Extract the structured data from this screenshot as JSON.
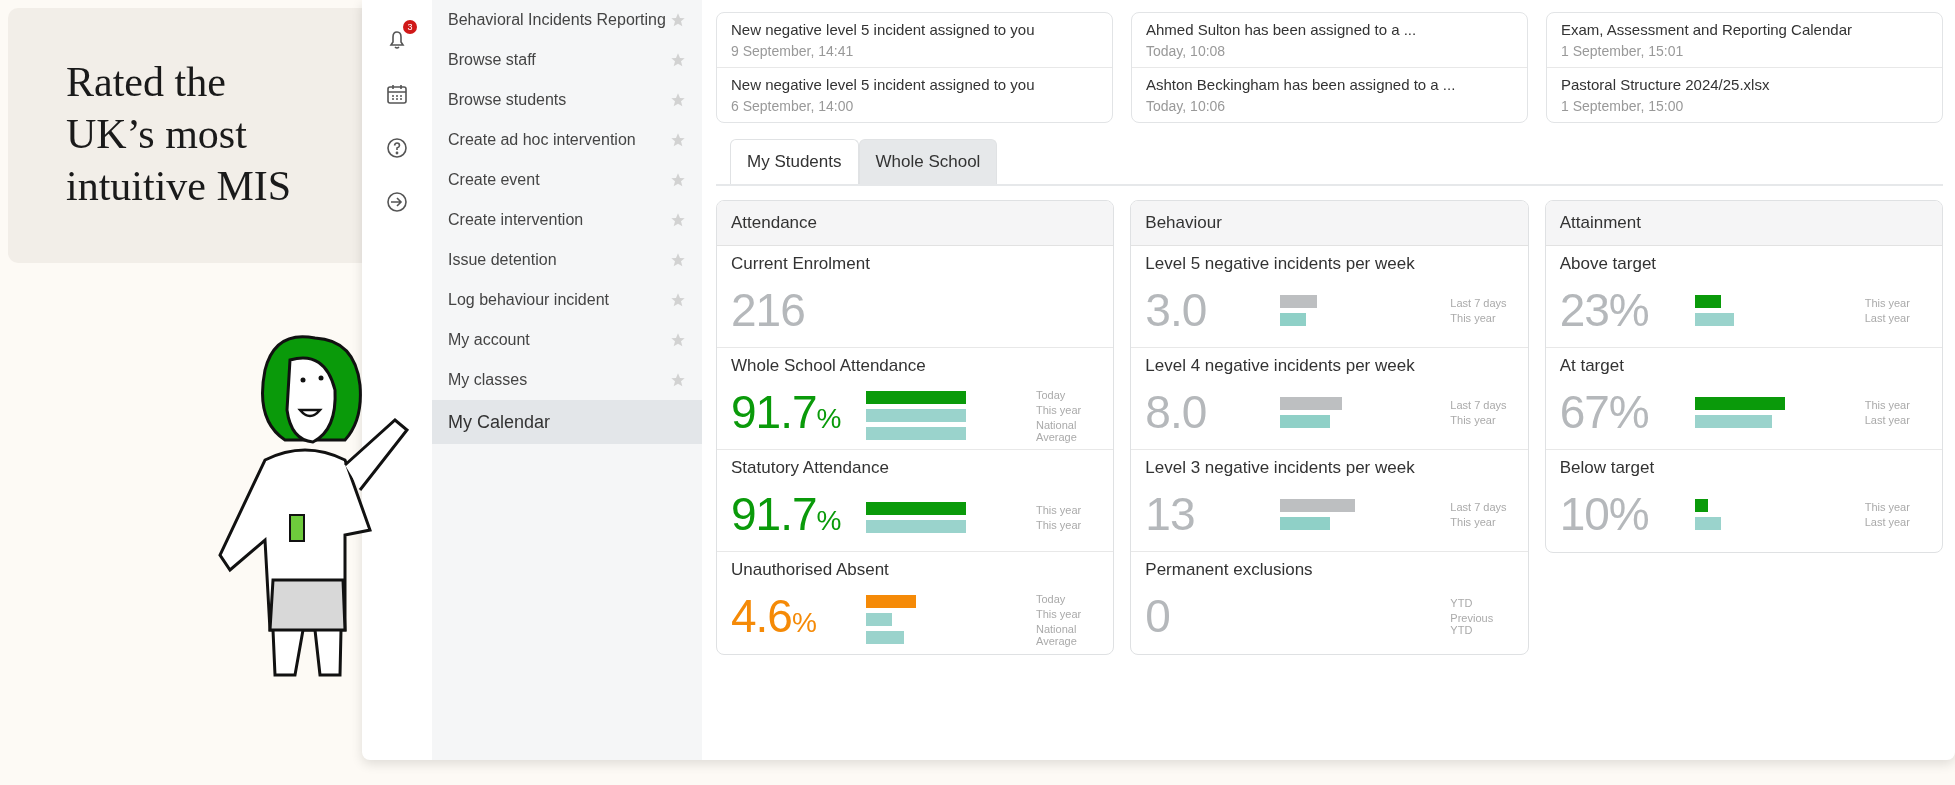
{
  "callout": {
    "text": "Rated the UK’s most intuitive MIS"
  },
  "nav_icons": [
    {
      "kind": "bell",
      "badge": "3"
    },
    {
      "kind": "calendar"
    },
    {
      "kind": "help"
    },
    {
      "kind": "logout"
    }
  ],
  "sidebar": {
    "items": [
      {
        "label": "Behavioral Incidents Reporting",
        "starred": false,
        "selected": false
      },
      {
        "label": "Browse staff",
        "starred": false,
        "selected": false
      },
      {
        "label": "Browse students",
        "starred": false,
        "selected": false
      },
      {
        "label": "Create ad hoc intervention",
        "starred": false,
        "selected": false
      },
      {
        "label": "Create event",
        "starred": false,
        "selected": false
      },
      {
        "label": "Create intervention",
        "starred": false,
        "selected": false
      },
      {
        "label": "Issue detention",
        "starred": false,
        "selected": false
      },
      {
        "label": "Log behaviour incident",
        "starred": false,
        "selected": false
      },
      {
        "label": "My account",
        "starred": false,
        "selected": false
      },
      {
        "label": "My classes",
        "starred": false,
        "selected": false
      },
      {
        "label": "My Calendar",
        "selected": true
      }
    ]
  },
  "notifications": [
    [
      {
        "title": "New negative level 5 incident assigned to you",
        "time": "9 September, 14:41"
      },
      {
        "title": "New negative level 5 incident assigned to you",
        "time": "6 September, 14:00"
      }
    ],
    [
      {
        "title": "Ahmed Sulton has been assigned to a ...",
        "time": "Today, 10:08"
      },
      {
        "title": "Ashton Beckingham has been assigned to a ...",
        "time": "Today, 10:06"
      }
    ],
    [
      {
        "title": "Exam, Assessment and Reporting Calendar",
        "time": "1 September, 15:01"
      },
      {
        "title": "Pastoral Structure 2024/25.xlsx",
        "time": "1 September, 15:00"
      }
    ]
  ],
  "tabs": [
    {
      "label": "My Students",
      "selected": true
    },
    {
      "label": "Whole School",
      "selected": false
    }
  ],
  "panels": [
    {
      "title": "Attendance",
      "metrics": [
        {
          "label": "Current Enrolment",
          "value": "216",
          "color": "#b5b8bb"
        },
        {
          "label": "Whole School Attendance",
          "value": "91.7",
          "unit": "%",
          "color": "#0a9a0a",
          "bars": [
            {
              "color": "#0a9a0a"
            },
            {
              "color": "#9ad3cc"
            },
            {
              "color": "#9ad3cc"
            }
          ],
          "legend": [
            "Today",
            "This year",
            "National Average"
          ]
        },
        {
          "label": "Statutory Attendance",
          "value": "91.7",
          "unit": "%",
          "color": "#0a9a0a",
          "bars": [
            {
              "color": "#0a9a0a"
            },
            {
              "color": "#9ad3cc"
            }
          ],
          "legend": [
            "This year",
            "This year"
          ]
        },
        {
          "label": "Unauthorised Absent",
          "value": "4.6",
          "unit": "%",
          "color": "#f58a07",
          "bars": [
            {
              "color": "#f58a07"
            },
            {
              "color": "#9ad3cc"
            },
            {
              "color": "#9ad3cc"
            }
          ],
          "legend": [
            "Today",
            "This year",
            "National Average"
          ]
        }
      ]
    },
    {
      "title": "Behaviour",
      "metrics": [
        {
          "label": "Level 5 negative incidents per week",
          "value": "3.0",
          "color": "#b5b8bb",
          "bars": [
            {
              "color": "#bdbfc1"
            },
            {
              "color": "#8fd0c7"
            }
          ],
          "legend": [
            "Last 7 days",
            "This year"
          ]
        },
        {
          "label": "Level 4 negative incidents per week",
          "value": "8.0",
          "color": "#b5b8bb",
          "bars": [
            {
              "color": "#bdbfc1"
            },
            {
              "color": "#8fd0c7"
            }
          ],
          "legend": [
            "Last 7 days",
            "This year"
          ]
        },
        {
          "label": "Level 3 negative incidents per week",
          "value": "13",
          "color": "#b5b8bb",
          "bars": [
            {
              "color": "#bdbfc1"
            },
            {
              "color": "#8fd0c7"
            }
          ],
          "legend": [
            "Last 7 days",
            "This year"
          ]
        },
        {
          "label": "Permanent exclusions",
          "value": "0",
          "color": "#b5b8bb",
          "legend": [
            "YTD",
            "Previous YTD"
          ]
        }
      ]
    },
    {
      "title": "Attainment",
      "metrics": [
        {
          "label": "Above target",
          "value": "23%",
          "color": "#b5b8bb",
          "bars": [
            {
              "color": "#0a9a0a"
            },
            {
              "color": "#9ad3cc"
            }
          ],
          "legend": [
            "This year",
            "Last year"
          ]
        },
        {
          "label": "At target",
          "value": "67%",
          "color": "#b5b8bb",
          "bars": [
            {
              "color": "#0a9a0a"
            },
            {
              "color": "#9ad3cc"
            }
          ],
          "legend": [
            "This year",
            "Last year"
          ]
        },
        {
          "label": "Below target",
          "value": "10%",
          "color": "#b5b8bb",
          "bars": [
            {
              "color": "#0a9a0a"
            },
            {
              "color": "#9ad3cc"
            }
          ],
          "legend": [
            "This year",
            "Last year"
          ]
        }
      ]
    }
  ]
}
